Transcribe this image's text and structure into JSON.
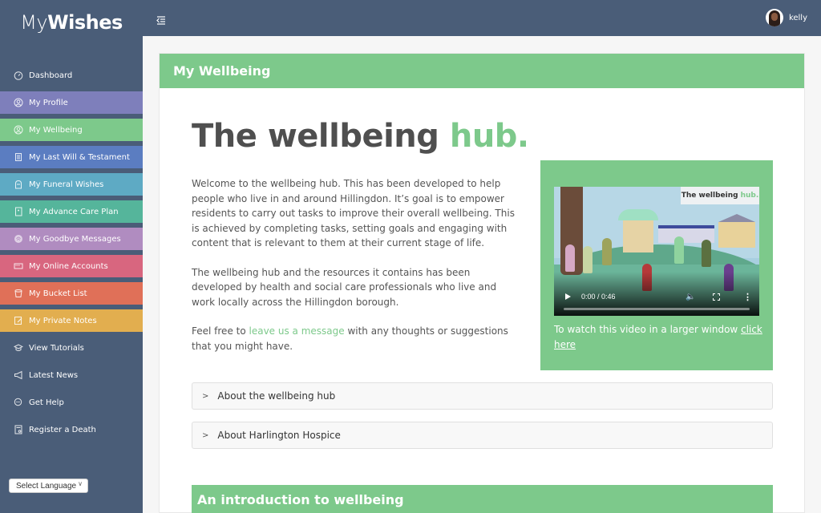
{
  "app": {
    "logo_light": "My",
    "logo_bold": "Wishes"
  },
  "sidebar": {
    "items": [
      {
        "label": "Dashboard",
        "icon": "dashboard-icon",
        "color": "#4a5d78"
      },
      {
        "label": "My Profile",
        "icon": "user-circle-icon",
        "color": "#7e7fbb"
      },
      {
        "label": "My Wellbeing",
        "icon": "user-circle-icon",
        "color": "#7dc98b"
      },
      {
        "label": "My Last Will & Testament",
        "icon": "scroll-icon",
        "color": "#5b7dc1"
      },
      {
        "label": "My Funeral Wishes",
        "icon": "headstone-icon",
        "color": "#5eaac4"
      },
      {
        "label": "My Advance Care Plan",
        "icon": "notebook-icon",
        "color": "#55b59b"
      },
      {
        "label": "My Goodbye Messages",
        "icon": "fingerprint-icon",
        "color": "#b08cc0"
      },
      {
        "label": "My Online Accounts",
        "icon": "password-icon",
        "color": "#d8667f"
      },
      {
        "label": "My Bucket List",
        "icon": "bucket-icon",
        "color": "#e07058"
      },
      {
        "label": "My Private Notes",
        "icon": "notes-icon",
        "color": "#e2ae4f"
      },
      {
        "label": "View Tutorials",
        "icon": "graduation-cap-icon",
        "color": "#4a5d78"
      },
      {
        "label": "Latest News",
        "icon": "megaphone-icon",
        "color": "#4a5d78"
      },
      {
        "label": "Get Help",
        "icon": "chat-icon",
        "color": "#4a5d78"
      },
      {
        "label": "Register a Death",
        "icon": "certificate-icon",
        "color": "#4a5d78"
      }
    ],
    "language_select": "Select Language"
  },
  "topbar": {
    "username": "kelly"
  },
  "page": {
    "header": "My Wellbeing",
    "hero_title": "The wellbeing",
    "hero_accent": "hub.",
    "paragraphs": {
      "p1": "Welcome to the wellbeing hub. This has been developed to help people who live in and around Hillingdon. It’s goal is to empower residents to carry out tasks to improve their overall wellbeing. This is achieved by completing tasks, setting goals and engaging with content that is relevant to them at their current stage of life.",
      "p2": "The wellbeing hub and the resources it contains has been developed by health and social care professionals who live and work locally across the Hillingdon borough.",
      "p3_before": "Feel free to ",
      "p3_link": "leave us a message",
      "p3_after": " with any thoughts or suggestions that you might have."
    },
    "video": {
      "badge_text": "The wellbeing",
      "badge_accent": "hub.",
      "current_time": "0:00",
      "duration": "0:46",
      "time_display": "0:00 / 0:46",
      "progress_percent": 0,
      "caption_before": "To watch this video in a larger window ",
      "caption_link": "click here"
    },
    "accordions": [
      {
        "label": "About the wellbeing hub"
      },
      {
        "label": "About Harlington Hospice"
      }
    ],
    "section_title": "An introduction to wellbeing"
  },
  "colors": {
    "brand_navy": "#4a5d78",
    "accent_green": "#7dc98b"
  }
}
